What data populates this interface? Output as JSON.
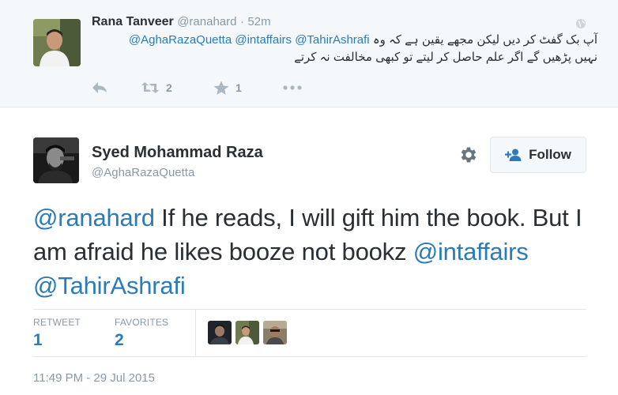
{
  "parent_tweet": {
    "fullname": "Rana Tanveer",
    "screen_name": "@ranahard",
    "separator": "·",
    "time": "52m",
    "mentions": [
      "@AghaRazaQuetta",
      "@intaffairs",
      "@TahirAshrafi"
    ],
    "text_line1_urdu": "آپ بک گفٹ کر دیں لیکن مجھے یقین ہے کہ وہ",
    "text_line2_urdu": "نہیں پڑھیں گے اگر علم حاصل کر لیتے تو کبھی مخالفت نہ کرتے",
    "retweet_count": "2",
    "favorite_count": "1",
    "icons": [
      "reply-icon",
      "retweet-icon",
      "favorite-star-icon",
      "more-icon",
      "globe-icon"
    ]
  },
  "main_tweet": {
    "fullname": "Syed Mohammad Raza",
    "screen_name": "@AghaRazaQuetta",
    "follow_label": "Follow",
    "text_parts": {
      "mention1": "@ranahard",
      "body": " If he reads, I will gift him the book. But I am afraid he likes booze not bookz ",
      "mention2": "@intaffairs",
      "space": " ",
      "mention3": "@TahirAshrafi"
    },
    "stats": {
      "retweet_label": "RETWEET",
      "retweet_count": "1",
      "favorites_label": "FAVORITES",
      "favorites_count": "2"
    },
    "timestamp": "11:49 PM - 29 Jul 2015",
    "icons": [
      "gear-icon",
      "follow-person-icon"
    ]
  },
  "colors": {
    "link": "#2b7bb9",
    "muted": "#8899a6",
    "text": "#292f33",
    "parent_background": "#f5f8fa",
    "divider": "#e1e8ed"
  }
}
